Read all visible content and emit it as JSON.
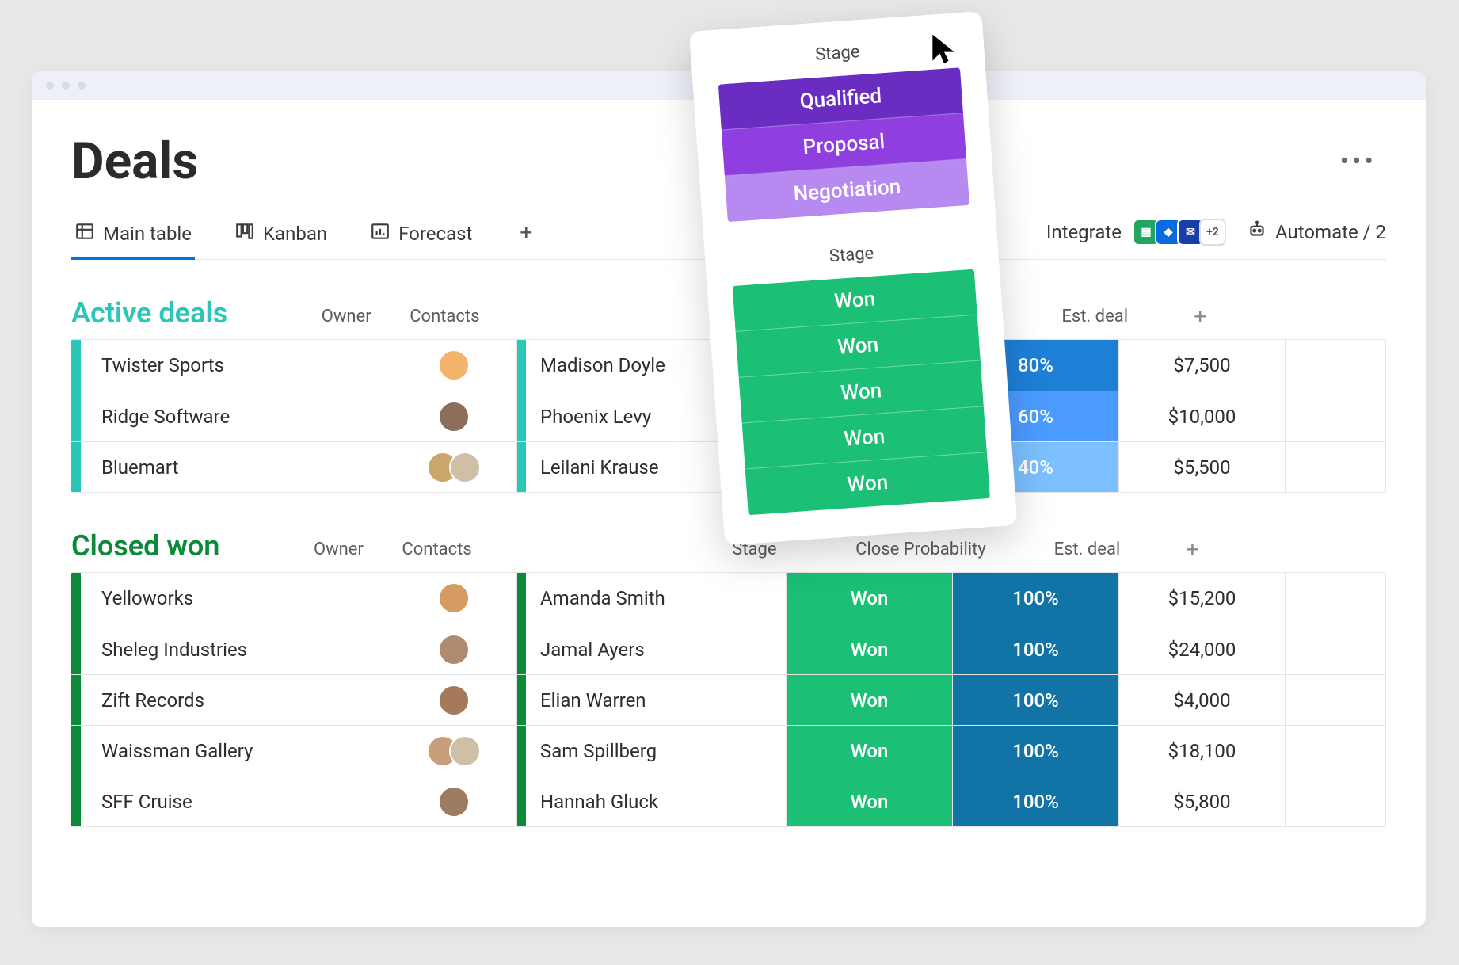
{
  "page": {
    "title": "Deals"
  },
  "tabs": {
    "main_table": "Main table",
    "kanban": "Kanban",
    "forecast": "Forecast"
  },
  "toolbar": {
    "integrate": "Integrate",
    "integrate_more": "+2",
    "automate": "Automate / 2"
  },
  "columns": {
    "owner": "Owner",
    "contacts": "Contacts",
    "stage": "Stage",
    "probability": "Close Probability",
    "value": "Est. deal"
  },
  "groups": {
    "active": {
      "title": "Active deals",
      "accent": "#2bc6b8",
      "rows": [
        {
          "name": "Twister Sports",
          "owner_color": "#f2b36a",
          "contact": "Madison Doyle",
          "stage": "Qualified",
          "stage_color": "#6b2cc2",
          "prob": "80%",
          "prob_color": "#1e7fd6",
          "value": "$7,500"
        },
        {
          "name": "Ridge Software",
          "owner_color": "#8c6f5a",
          "contact": "Phoenix Levy",
          "stage": "Proposal",
          "stage_color": "#8f3ee0",
          "prob": "60%",
          "prob_color": "#4b9bff",
          "value": "$10,000"
        },
        {
          "name": "Bluemart",
          "owner_color": "#c9a66a",
          "contact": "Leilani Krause",
          "stage": "Negotiation",
          "stage_color": "#b78af2",
          "prob": "40%",
          "prob_color": "#7cc0ff",
          "value": "$5,500"
        }
      ]
    },
    "closed": {
      "title": "Closed won",
      "accent": "#0d893a",
      "rows": [
        {
          "name": "Yelloworks",
          "owner_color": "#d69a63",
          "contact": "Amanda Smith",
          "stage": "Won",
          "stage_color": "#1bbf75",
          "prob": "100%",
          "prob_color": "#1173a6",
          "value": "$15,200"
        },
        {
          "name": "Sheleg Industries",
          "owner_color": "#b08b70",
          "contact": "Jamal Ayers",
          "stage": "Won",
          "stage_color": "#1bbf75",
          "prob": "100%",
          "prob_color": "#1173a6",
          "value": "$24,000"
        },
        {
          "name": "Zift Records",
          "owner_color": "#a5795c",
          "contact": "Elian Warren",
          "stage": "Won",
          "stage_color": "#1bbf75",
          "prob": "100%",
          "prob_color": "#1173a6",
          "value": "$4,000"
        },
        {
          "name": "Waissman Gallery",
          "owner_color": "#c79d7a",
          "contact": "Sam Spillberg",
          "stage": "Won",
          "stage_color": "#1bbf75",
          "prob": "100%",
          "prob_color": "#1173a6",
          "value": "$18,100"
        },
        {
          "name": "SFF Cruise",
          "owner_color": "#9c7b62",
          "contact": "Hannah Gluck",
          "stage": "Won",
          "stage_color": "#1bbf75",
          "prob": "100%",
          "prob_color": "#1173a6",
          "value": "$5,800"
        }
      ]
    }
  },
  "popover": {
    "title_top": "Stage",
    "title_bottom": "Stage",
    "top": [
      {
        "label": "Qualified",
        "color": "#6b2cc2"
      },
      {
        "label": "Proposal",
        "color": "#8f3ee0"
      },
      {
        "label": "Negotiation",
        "color": "#b78af2"
      }
    ],
    "bottom": [
      {
        "label": "Won",
        "color": "#1bbf75"
      },
      {
        "label": "Won",
        "color": "#1bbf75"
      },
      {
        "label": "Won",
        "color": "#1bbf75"
      },
      {
        "label": "Won",
        "color": "#1bbf75"
      },
      {
        "label": "Won",
        "color": "#1bbf75"
      }
    ]
  },
  "colors": {
    "integrate_icons": [
      "#22a65f",
      "#0a6be0",
      "#1a3ea8"
    ]
  }
}
